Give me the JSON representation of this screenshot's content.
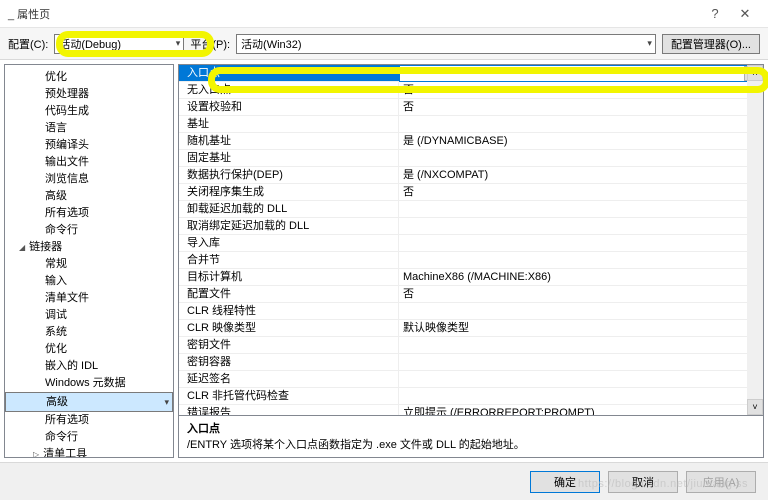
{
  "title": "_ 属性页",
  "titlebar": {
    "help": "?",
    "close": "✕"
  },
  "toolbar": {
    "config_label": "配置(C):",
    "config_value": "活动(Debug)",
    "platform_label": "平台(P):",
    "platform_value": "活动(Win32)",
    "manager": "配置管理器(O)..."
  },
  "tree": {
    "items": [
      "优化",
      "预处理器",
      "代码生成",
      "语言",
      "预编译头",
      "输出文件",
      "浏览信息",
      "高级",
      "所有选项",
      "命令行"
    ],
    "linker": "链接器",
    "linker_items": [
      "常规",
      "输入",
      "清单文件",
      "调试",
      "系统",
      "优化",
      "嵌入的 IDL",
      "Windows 元数据",
      "高级",
      "所有选项",
      "命令行"
    ],
    "manifest": "清单工具"
  },
  "grid": [
    {
      "k": "入口点",
      "v": ""
    },
    {
      "k": "无入口点",
      "v": "否"
    },
    {
      "k": "设置校验和",
      "v": "否"
    },
    {
      "k": "基址",
      "v": ""
    },
    {
      "k": "随机基址",
      "v": "是 (/DYNAMICBASE)"
    },
    {
      "k": "固定基址",
      "v": ""
    },
    {
      "k": "数据执行保护(DEP)",
      "v": "是 (/NXCOMPAT)"
    },
    {
      "k": "关闭程序集生成",
      "v": "否"
    },
    {
      "k": "卸载延迟加载的 DLL",
      "v": ""
    },
    {
      "k": "取消绑定延迟加载的 DLL",
      "v": ""
    },
    {
      "k": "导入库",
      "v": ""
    },
    {
      "k": "合并节",
      "v": ""
    },
    {
      "k": "目标计算机",
      "v": "MachineX86 (/MACHINE:X86)"
    },
    {
      "k": "配置文件",
      "v": "否"
    },
    {
      "k": "CLR 线程特性",
      "v": ""
    },
    {
      "k": "CLR 映像类型",
      "v": "默认映像类型"
    },
    {
      "k": "密钥文件",
      "v": ""
    },
    {
      "k": "密钥容器",
      "v": ""
    },
    {
      "k": "延迟签名",
      "v": ""
    },
    {
      "k": "CLR 非托管代码检查",
      "v": ""
    },
    {
      "k": "错误报告",
      "v": "立即提示 (/ERRORREPORT:PROMPT)"
    }
  ],
  "desc": {
    "title": "入口点",
    "text": "/ENTRY 选项将某个入口点函数指定为 .exe 文件或 DLL 的起始地址。"
  },
  "footer": {
    "ok": "确定",
    "cancel": "取消",
    "apply": "应用(A)"
  },
  "watermark": "https://blog.csdn.net/jiuniang.ss"
}
